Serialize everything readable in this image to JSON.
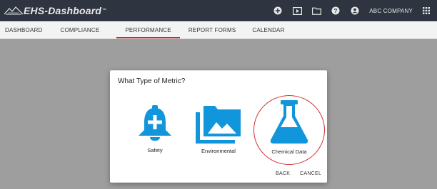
{
  "app": {
    "title": "EHS-Dashboard",
    "trademark": "™",
    "company": "ABC COMPANY"
  },
  "header_icons": [
    "add-circle-icon",
    "media-icon",
    "folder-icon",
    "help-icon",
    "account-icon",
    "apps-grid-icon"
  ],
  "nav": {
    "tabs": [
      {
        "label": "DASHBOARD",
        "active": false
      },
      {
        "label": "COMPLIANCE",
        "active": false
      },
      {
        "label": "PERFORMANCE",
        "active": true
      },
      {
        "label": "REPORT FORMS",
        "active": false
      },
      {
        "label": "CALENDAR",
        "active": false
      }
    ]
  },
  "dialog": {
    "title": "What Type of Metric?",
    "options": [
      {
        "label": "Safety",
        "icon": "bell-plus-icon"
      },
      {
        "label": "Environmental",
        "icon": "image-collection-icon"
      },
      {
        "label": "Chemical Data",
        "icon": "flask-icon",
        "highlighted": true
      }
    ],
    "back_label": "BACK",
    "cancel_label": "CANCEL"
  },
  "colors": {
    "accent_blue": "#1296db",
    "header_bg": "#2e3440",
    "active_tab_underline": "#c62828",
    "highlight_circle": "#d32f2f"
  }
}
